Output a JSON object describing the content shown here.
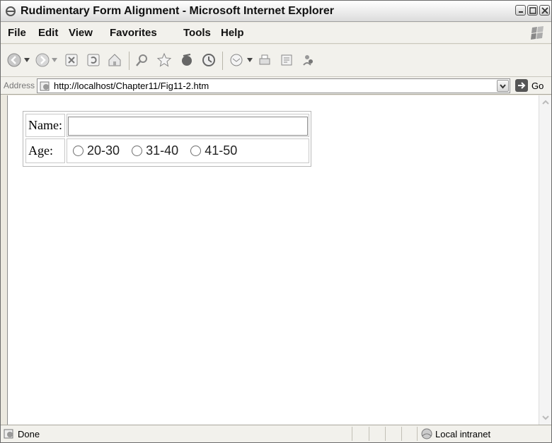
{
  "window": {
    "title": "Rudimentary Form Alignment - Microsoft Internet Explorer"
  },
  "menu": [
    "File",
    "Edit",
    "View",
    "Favorites",
    "Tools",
    "Help"
  ],
  "address": {
    "label": "Address",
    "url": "http://localhost/Chapter11/Fig11-2.htm",
    "go_label": "Go"
  },
  "form": {
    "name_label": "Name:",
    "name_value": "",
    "age_label": "Age:",
    "age_options": [
      "20-30",
      "31-40",
      "41-50"
    ]
  },
  "status": {
    "text": "Done",
    "zone": "Local intranet"
  },
  "icons": {
    "toolbar": [
      "back-icon",
      "forward-icon",
      "stop-icon",
      "refresh-icon",
      "home-icon",
      "search-icon",
      "favorites-icon",
      "media-icon",
      "history-icon",
      "mail-icon",
      "print-icon",
      "edit-icon",
      "messenger-icon"
    ]
  },
  "colors": {
    "window_bg": "#ece9e0",
    "content_bg": "#ffffff"
  }
}
